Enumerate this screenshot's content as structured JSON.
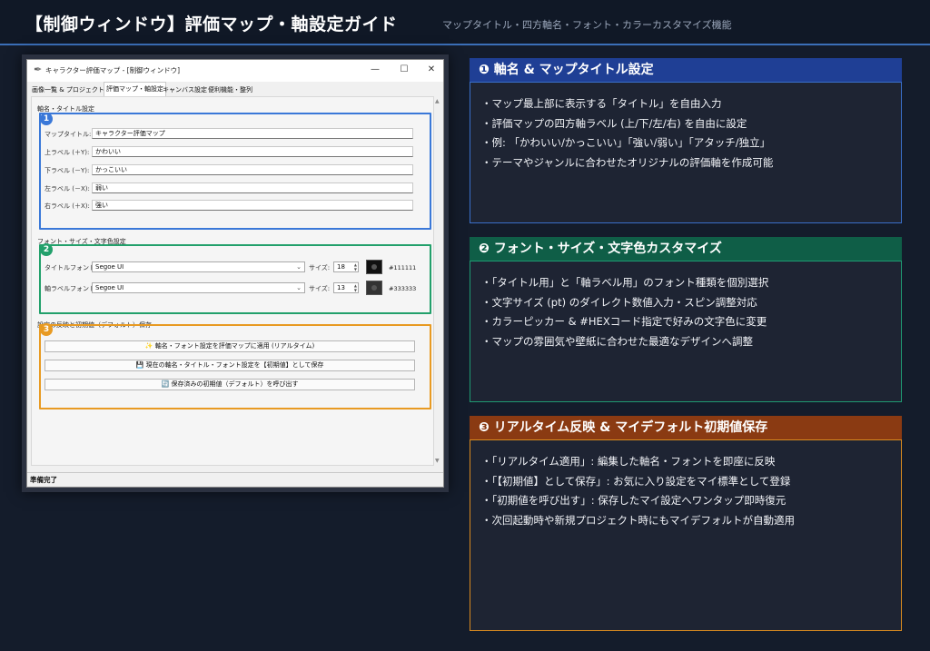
{
  "header": {
    "title": "【制御ウィンドウ】評価マップ・軸設定ガイド",
    "subtitle": "マップタイトル・四方軸名・フォント・カラーカスタマイズ機能"
  },
  "window": {
    "title": "キャラクター評価マップ - [制御ウィンドウ]",
    "tabs": [
      "画像一覧 & プロジェクト",
      "評価マップ・軸設定",
      "キャンバス設定",
      "便利機能・整列"
    ],
    "section1_label": "軸名・タイトル設定",
    "fields": [
      {
        "label": "マップタイトル:",
        "value": "キャラクター評価マップ"
      },
      {
        "label": "上ラベル (＋Y):",
        "value": "かわいい"
      },
      {
        "label": "下ラベル (－Y):",
        "value": "かっこいい"
      },
      {
        "label": "左ラベル (－X):",
        "value": "弱い"
      },
      {
        "label": "右ラベル (＋X):",
        "value": "強い"
      }
    ],
    "section2_label": "フォント・サイズ・文字色設定",
    "font_rows": [
      {
        "label": "タイトルフォント:",
        "font": "Segoe UI",
        "size_label": "サイズ:",
        "size": "18",
        "color": "#111111"
      },
      {
        "label": "軸ラベルフォント:",
        "font": "Segoe UI",
        "size_label": "サイズ:",
        "size": "13",
        "color": "#333333"
      }
    ],
    "section3_label": "設定の反映と初期値（デフォルト）保存",
    "buttons": [
      "✨ 軸名・フォント設定を評価マップに適用 (リアルタイム)",
      "💾 現在の軸名・タイトル・フォント設定を【初期値】として保存",
      "🔄 保存済みの初期値（デフォルト）を呼び出す"
    ],
    "badges": [
      "1",
      "2",
      "3"
    ],
    "status": "準備完了"
  },
  "panels": [
    {
      "title": "❶ 軸名 & マップタイトル設定",
      "color": "#1f3f95",
      "items": [
        "・マップ最上部に表示する「タイトル」を自由入力",
        "・評価マップの四方軸ラベル (上/下/左/右) を自由に設定",
        "・例: 「かわいい/かっこいい」「強い/弱い」「アタッチ/独立」",
        "・テーマやジャンルに合わせたオリジナルの評価軸を作成可能"
      ]
    },
    {
      "title": "❷ フォント・サイズ・文字色カスタマイズ",
      "color": "#0f5e47",
      "items": [
        "・「タイトル用」と「軸ラベル用」のフォント種類を個別選択",
        "・文字サイズ (pt) のダイレクト数値入力・スピン調整対応",
        "・カラーピッカー & #HEXコード指定で好みの文字色に変更",
        "・マップの雰囲気や壁紙に合わせた最適なデザインへ調整"
      ]
    },
    {
      "title": "❸ リアルタイム反映 & マイデフォルト初期値保存",
      "color": "#8a3a12",
      "items": [
        "・「リアルタイム適用」: 編集した軸名・フォントを即座に反映",
        "・「【初期値】として保存」: お気に入り設定をマイ標準として登録",
        "・「初期値を呼び出す」: 保存したマイ設定へワンタップ即時復元",
        "・次回起動時や新規プロジェクト時にもマイデフォルトが自動適用"
      ]
    }
  ],
  "colors": {
    "blue": "#3a78d8",
    "green": "#22a06b",
    "orange": "#e89a22"
  }
}
